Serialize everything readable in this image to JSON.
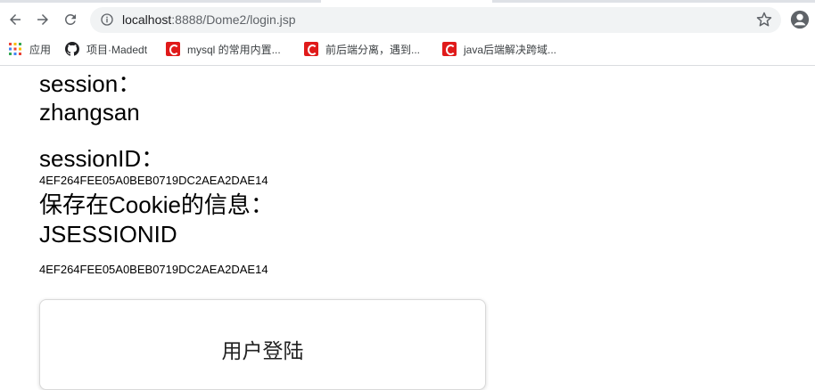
{
  "browser": {
    "url_host": "localhost",
    "url_path": ":8888/Dome2/login.jsp",
    "bookmarks": [
      {
        "label": "应用",
        "icon": "apps-grid-icon"
      },
      {
        "label": "项目·Madedt",
        "icon": "github-icon"
      },
      {
        "label": "mysql 的常用内置...",
        "icon": "csdn-icon"
      },
      {
        "label": "前后端分离，遇到...",
        "icon": "csdn-icon"
      },
      {
        "label": "java后端解决跨域...",
        "icon": "csdn-icon"
      }
    ]
  },
  "page": {
    "session_label": "session：",
    "session_value": "zhangsan",
    "session_id_label": "sessionID：",
    "session_id_value": "4EF264FEE05A0BEB0719DC2AEA2DAE14",
    "cookie_label": "保存在Cookie的信息：",
    "cookie_name": "JSESSIONID",
    "cookie_value": "4EF264FEE05A0BEB0719DC2AEA2DAE14",
    "login_title": "用户登陆"
  },
  "colors": {
    "csdn_red": "#e01a1a",
    "omnibox_bg": "#f1f3f4"
  }
}
